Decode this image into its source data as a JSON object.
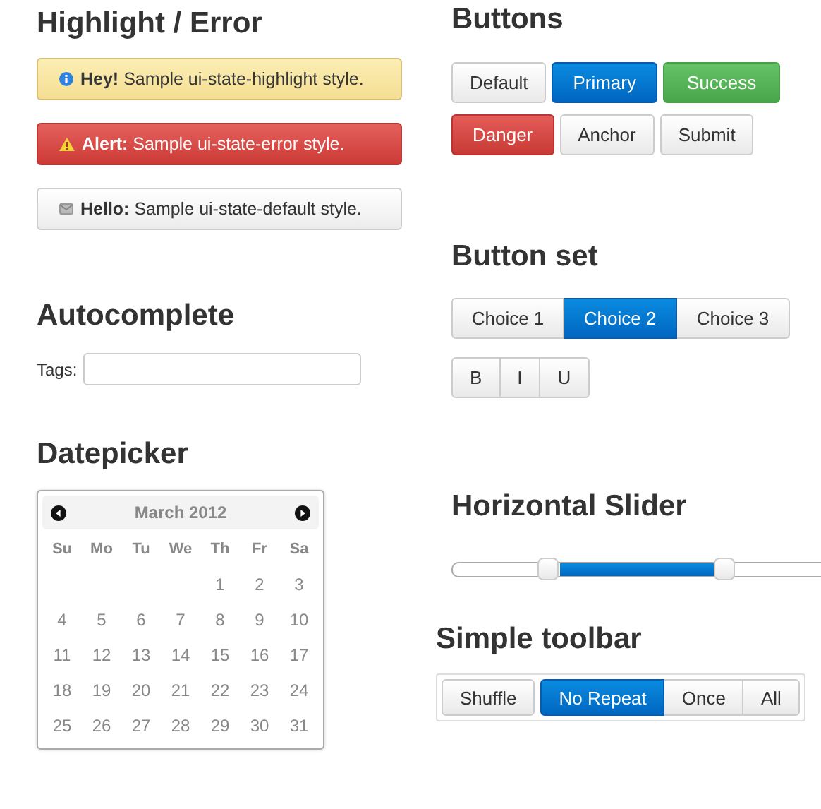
{
  "highlight_error": {
    "title": "Highlight / Error",
    "alerts": [
      {
        "kind": "highlight",
        "text": "**Hey!** Sample ui-state-highlight style."
      },
      {
        "kind": "error",
        "text": "**Alert:** Sample ui-state-error style."
      },
      {
        "kind": "default",
        "text": "**Hello:** Sample ui-state-default style."
      }
    ]
  },
  "autocomplete": {
    "title": "Autocomplete",
    "label": "Tags:"
  },
  "datepicker": {
    "title": "Datepicker",
    "month": "March 2012",
    "weekdays": [
      "Su",
      "Mo",
      "Tu",
      "We",
      "Th",
      "Fr",
      "Sa"
    ],
    "weeks": [
      [
        "1",
        "2",
        "3"
      ],
      [
        "4",
        "5",
        "6",
        "7",
        "8",
        "9",
        "10"
      ],
      [
        "11",
        "12",
        "13",
        "14",
        "15",
        "16",
        "17"
      ],
      [
        "18",
        "19",
        "20",
        "21",
        "22",
        "23",
        "24"
      ],
      [
        "25",
        "26",
        "27",
        "28",
        "29",
        "30",
        "31"
      ]
    ]
  },
  "buttons": {
    "title": "Buttons",
    "rows": [
      [
        {
          "label": "Default",
          "kind": "default"
        },
        {
          "label": "Primary",
          "kind": "primary"
        },
        {
          "label": "Success",
          "kind": "success"
        }
      ],
      [
        {
          "label": "Danger",
          "kind": "danger"
        },
        {
          "label": "Anchor",
          "kind": "default"
        },
        {
          "label": "Submit",
          "kind": "default"
        }
      ]
    ]
  },
  "button_set": {
    "title": "Button set",
    "groups": [
      [
        {
          "label": "Choice 1",
          "selected": false
        },
        {
          "label": "Choice 2",
          "selected": true
        },
        {
          "label": "Choice 3",
          "selected": false
        }
      ],
      [
        {
          "label": "B",
          "selected": false
        },
        {
          "label": "I",
          "selected": false
        },
        {
          "label": "U",
          "selected": false
        }
      ]
    ]
  },
  "slider": {
    "title": "Horizontal Slider",
    "handles": [
      {
        "level": 0.26
      },
      {
        "level": 0.74
      }
    ]
  },
  "toolbar": {
    "title": "Simple toolbar",
    "groups": [
      [
        {
          "label": "Shuffle",
          "selected": false
        }
      ],
      [
        {
          "label": "No Repeat",
          "selected": true
        },
        {
          "label": "Once",
          "selected": false
        },
        {
          "label": "All",
          "selected": false
        }
      ]
    ]
  }
}
